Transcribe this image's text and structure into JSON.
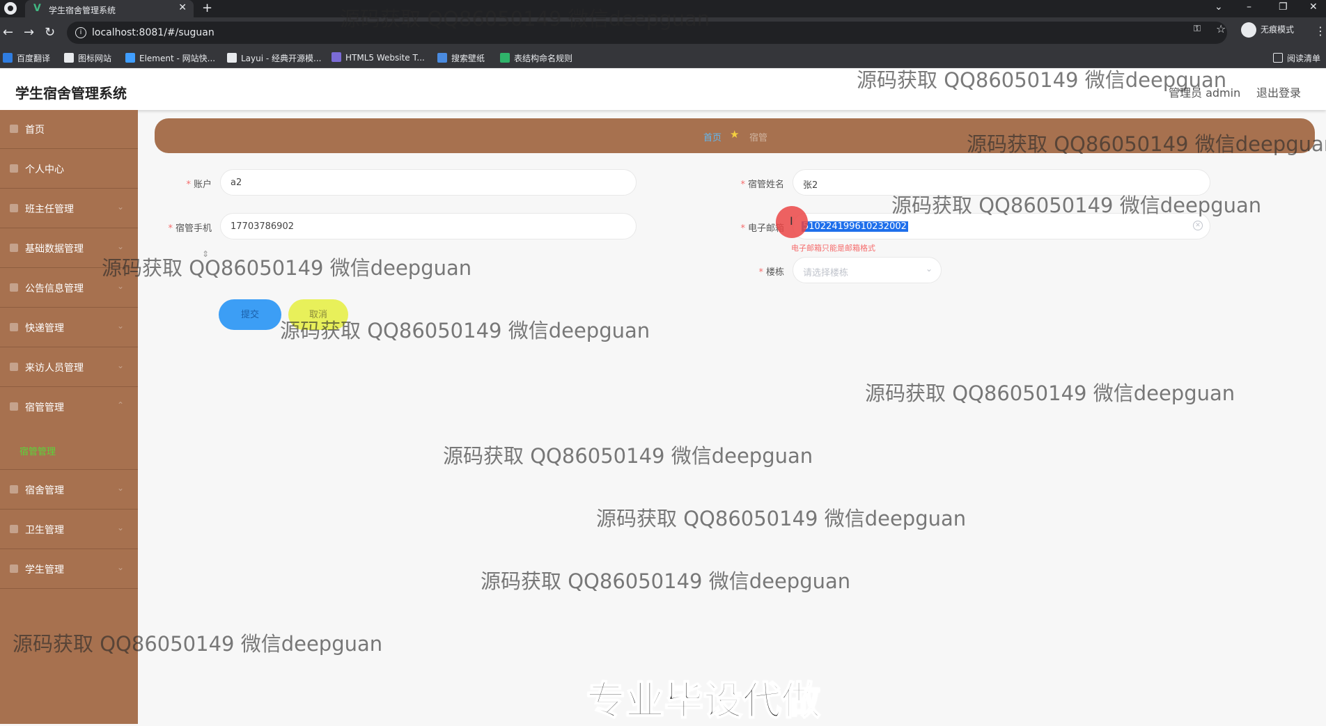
{
  "browser": {
    "tab_title": "学生宿舍管理系统",
    "url": "localhost:8081/#/suguan",
    "incognito_label": "无痕模式",
    "reading_list": "阅读清单",
    "bookmarks": [
      "百度翻译",
      "图标网站",
      "Element - 网站快...",
      "Layui - 经典开源模...",
      "HTML5 Website T...",
      "搜索壁纸",
      "表结构命名规则"
    ]
  },
  "header": {
    "title": "学生宿舍管理系统",
    "admin": "管理员 admin",
    "logout": "退出登录"
  },
  "sidebar": {
    "items": [
      {
        "label": "首页"
      },
      {
        "label": "个人中心"
      },
      {
        "label": "班主任管理"
      },
      {
        "label": "基础数据管理"
      },
      {
        "label": "公告信息管理"
      },
      {
        "label": "快递管理"
      },
      {
        "label": "来访人员管理"
      },
      {
        "label": "宿管管理"
      },
      {
        "label": "宿舍管理"
      },
      {
        "label": "卫生管理"
      },
      {
        "label": "学生管理"
      }
    ],
    "sub_item": "宿管管理"
  },
  "breadcrumb": {
    "home": "首页",
    "current": "宿管"
  },
  "form": {
    "account_label": "账户",
    "account_value": "a2",
    "name_label": "宿管姓名",
    "name_value": "张2",
    "phone_label": "宿管手机",
    "phone_value": "17703786902",
    "email_label": "电子邮箱",
    "email_value": "5102241996102320​02",
    "email_error": "电子邮箱只能是邮箱格式",
    "building_label": "楼栋",
    "building_placeholder": "请选择楼栋",
    "submit": "提交",
    "cancel": "取消"
  },
  "watermark": "源码获取 QQ86050149 微信deepguan",
  "banner": "专业毕设代做"
}
